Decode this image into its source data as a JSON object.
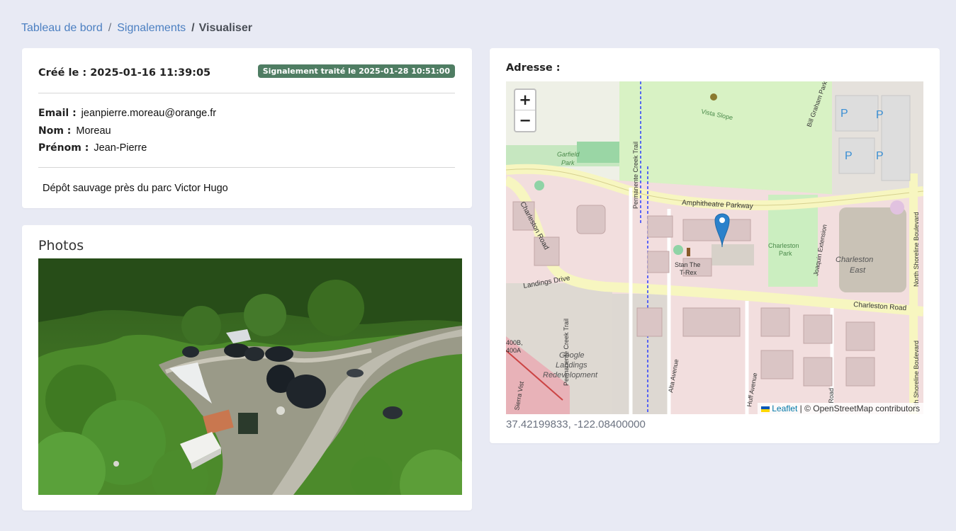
{
  "breadcrumb": {
    "home": "Tableau de bord",
    "separator": "/",
    "section": "Signalements",
    "current": "Visualiser"
  },
  "report": {
    "created": "Créé le : 2025-01-16 11:39:05",
    "status": "Signalement traité le 2025-01-28 10:51:00",
    "email_label": "Email :",
    "email": "jeanpierre.moreau@orange.fr",
    "nom_label": "Nom :",
    "nom": "Moreau",
    "prenom_label": "Prénom :",
    "prenom": "Jean-Pierre",
    "description": "Dépôt sauvage près du parc Victor Hugo"
  },
  "photos": {
    "title": "Photos"
  },
  "address": {
    "label": "Adresse :",
    "coords": "37.42199833, -122.08400000"
  },
  "map": {
    "zoom_in": "+",
    "zoom_out": "−",
    "attribution_link": "Leaflet",
    "attribution_text": " | © OpenStreetMap contributors",
    "labels": {
      "amphitheatre": "Amphitheatre Parkway",
      "charleston_road": "Charleston Road",
      "charleston_road_w": "Charleston Road",
      "landings_drive": "Landings Drive",
      "permanente_1": "Permanente Creek Trail",
      "permanente_2": "Permanente Creek Trail",
      "north_shoreline": "North Shoreline Boulevard",
      "north_shoreline_2": "rth Shoreline Boulevard",
      "charleston_east_1": "Charleston",
      "charleston_east_2": "East",
      "google_1": "Google",
      "google_2": "Landings",
      "google_3": "Redevelopment",
      "charleston_park_1": "Charleston",
      "charleston_park_2": "Park",
      "stan_1": "Stan The",
      "stan_2": "T-Rex",
      "garfield_1": "Garfield",
      "garfield_2": "Park",
      "vista": "Vista Slope",
      "bill_graham": "Bill Graham Parkway",
      "joaquin": "Joaquin Extension",
      "alta": "Alta Avenue",
      "huff": "Huff Avenue",
      "road_400b_1": "400B,",
      "road_400b_2": "400A",
      "sierra": "Sierra Vist",
      "parking": "P",
      "on_road": "on Road"
    }
  },
  "colors": {
    "background": "#e8eaf4",
    "link": "#4b7fc1",
    "badge": "#4f7d63",
    "marker": "#2a81cb"
  }
}
